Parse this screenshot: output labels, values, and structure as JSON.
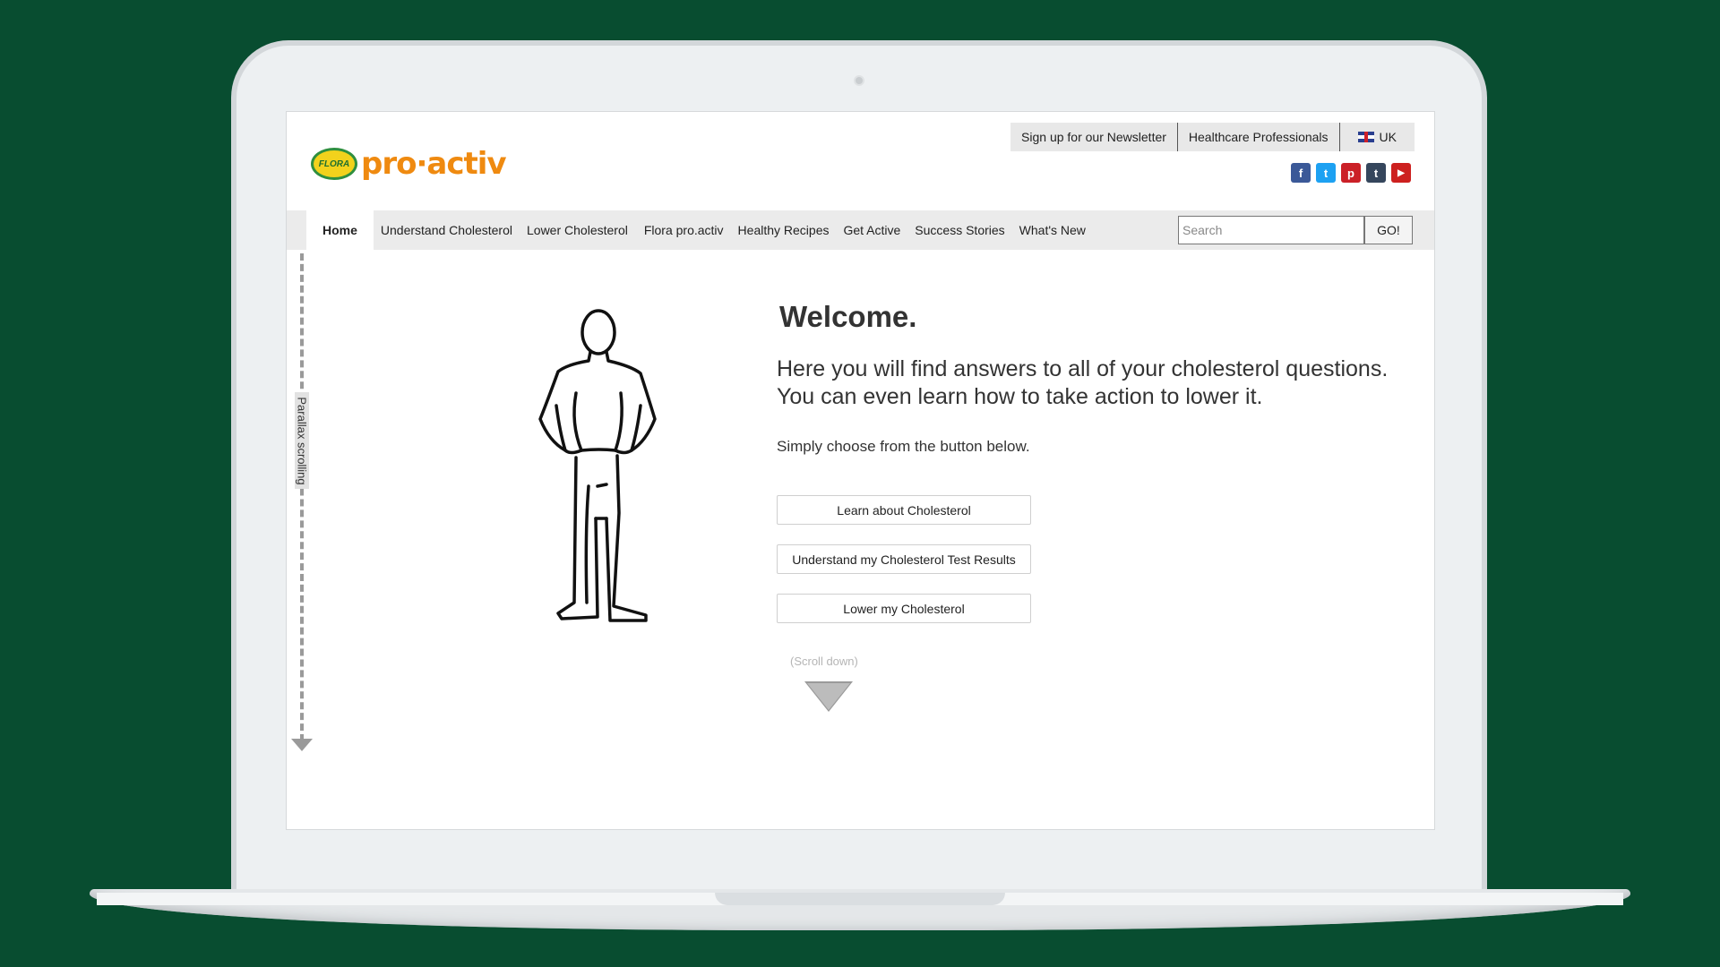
{
  "brand": {
    "logo_badge": "FLORA",
    "logo_text": "pro·activ"
  },
  "header": {
    "links": [
      "Sign up for our Newsletter",
      "Healthcare Professionals",
      "UK"
    ],
    "social": [
      {
        "icon": "facebook-icon",
        "glyph": "f",
        "color": "#3b5998"
      },
      {
        "icon": "twitter-icon",
        "glyph": "t",
        "color": "#1da1f2"
      },
      {
        "icon": "pinterest-icon",
        "glyph": "p",
        "color": "#cb2027"
      },
      {
        "icon": "tumblr-icon",
        "glyph": "t",
        "color": "#35465c"
      },
      {
        "icon": "youtube-icon",
        "glyph": "▶",
        "color": "#cd201f"
      }
    ]
  },
  "nav": {
    "items": [
      "Home",
      "Understand Cholesterol",
      "Lower Cholesterol",
      "Flora pro.activ",
      "Healthy Recipes",
      "Get Active",
      "Success Stories",
      "What's New"
    ],
    "search_placeholder": "Search",
    "go_label": "GO!"
  },
  "sidebar": {
    "parallax_label": "Parallax scrolling"
  },
  "main": {
    "title": "Welcome.",
    "intro": "Here you will find answers to all of your cholesterol questions. You can even learn how to take action to lower it.",
    "choose": "Simply choose from the button below.",
    "buttons": [
      "Learn about Cholesterol",
      "Understand my Cholesterol Test Results",
      "Lower my Cholesterol"
    ],
    "scroll_label": "(Scroll down)"
  },
  "colors": {
    "background": "#084d30",
    "brand_orange": "#ef8a10",
    "brand_green": "#2f8f3f"
  }
}
